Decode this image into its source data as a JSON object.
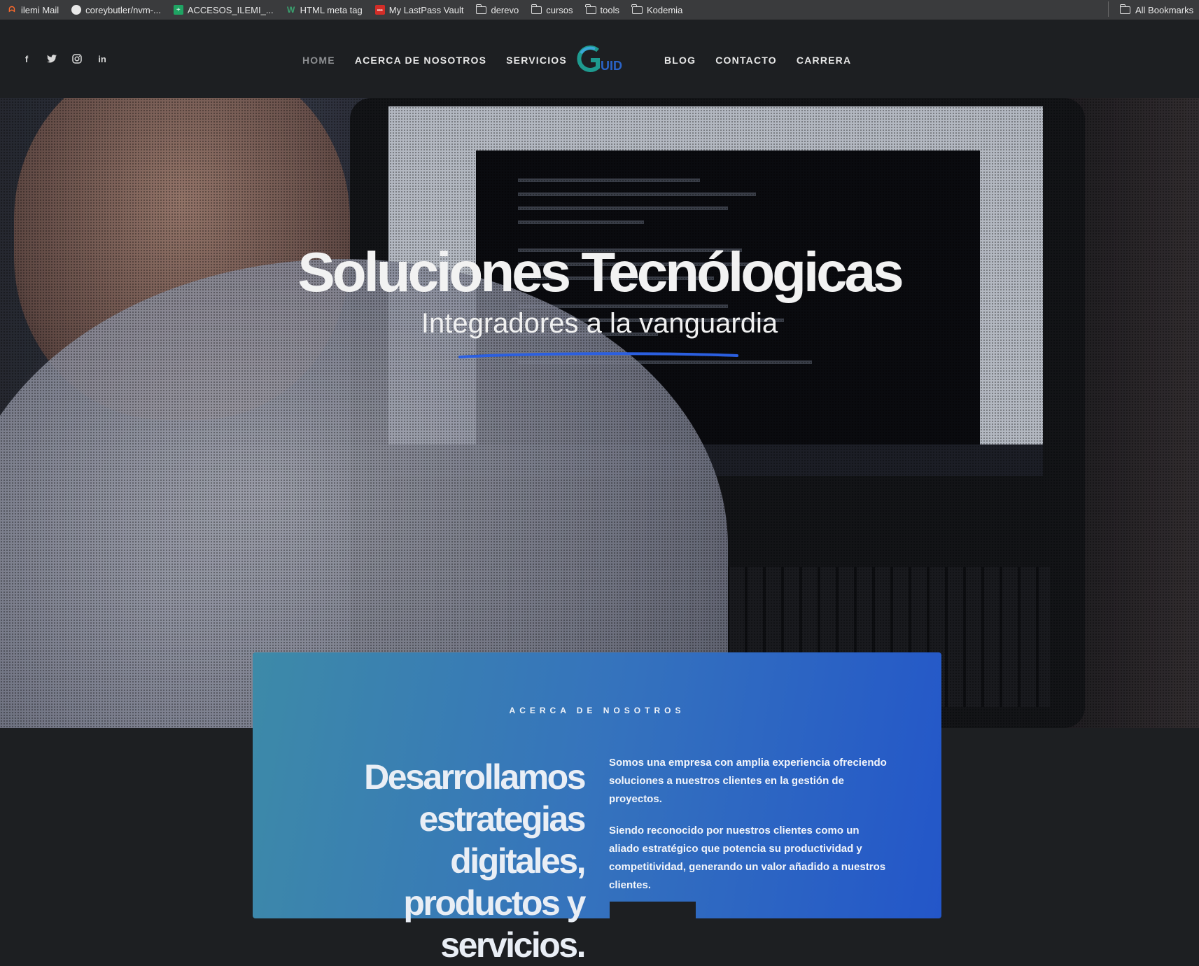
{
  "bookmarks": {
    "items": [
      {
        "label": "ilemi Mail",
        "icon": "mail-icon"
      },
      {
        "label": "coreybutler/nvm-...",
        "icon": "github-icon"
      },
      {
        "label": "ACCESOS_ILEMI_...",
        "icon": "sheets-icon"
      },
      {
        "label": "HTML meta tag",
        "icon": "webmaster-icon"
      },
      {
        "label": "My LastPass Vault",
        "icon": "lastpass-icon"
      },
      {
        "label": "derevo",
        "icon": "folder-icon"
      },
      {
        "label": "cursos",
        "icon": "folder-icon"
      },
      {
        "label": "tools",
        "icon": "folder-icon"
      },
      {
        "label": "Kodemia",
        "icon": "folder-icon"
      }
    ],
    "all_label": "All Bookmarks"
  },
  "header": {
    "social": [
      "facebook-icon",
      "twitter-icon",
      "instagram-icon",
      "linkedin-icon"
    ],
    "nav_left": [
      "HOME",
      "ACERCA DE NOSOTROS",
      "SERVICIOS"
    ],
    "nav_right": [
      "BLOG",
      "CONTACTO",
      "CARRERA"
    ],
    "logo_text": "UID"
  },
  "hero": {
    "title": "Soluciones Tecnólogicas",
    "subtitle": "Integradores a la vanguardia"
  },
  "about": {
    "eyebrow": "ACERCA DE NOSOTROS",
    "headline": "Desarrollamos estrategias digitales, productos y servicios.",
    "paragraph1": "Somos una empresa con amplia experiencia ofreciendo soluciones a nuestros clientes en la gestión de proyectos.",
    "paragraph2": "Siendo reconocido por nuestros clientes como un aliado estratégico que potencia su productividad y competitividad, generando un valor añadido a nuestros clientes."
  },
  "colors": {
    "accent": "#2356c9",
    "card_start": "#3d8aa8",
    "header_bg": "#1d1f22"
  }
}
